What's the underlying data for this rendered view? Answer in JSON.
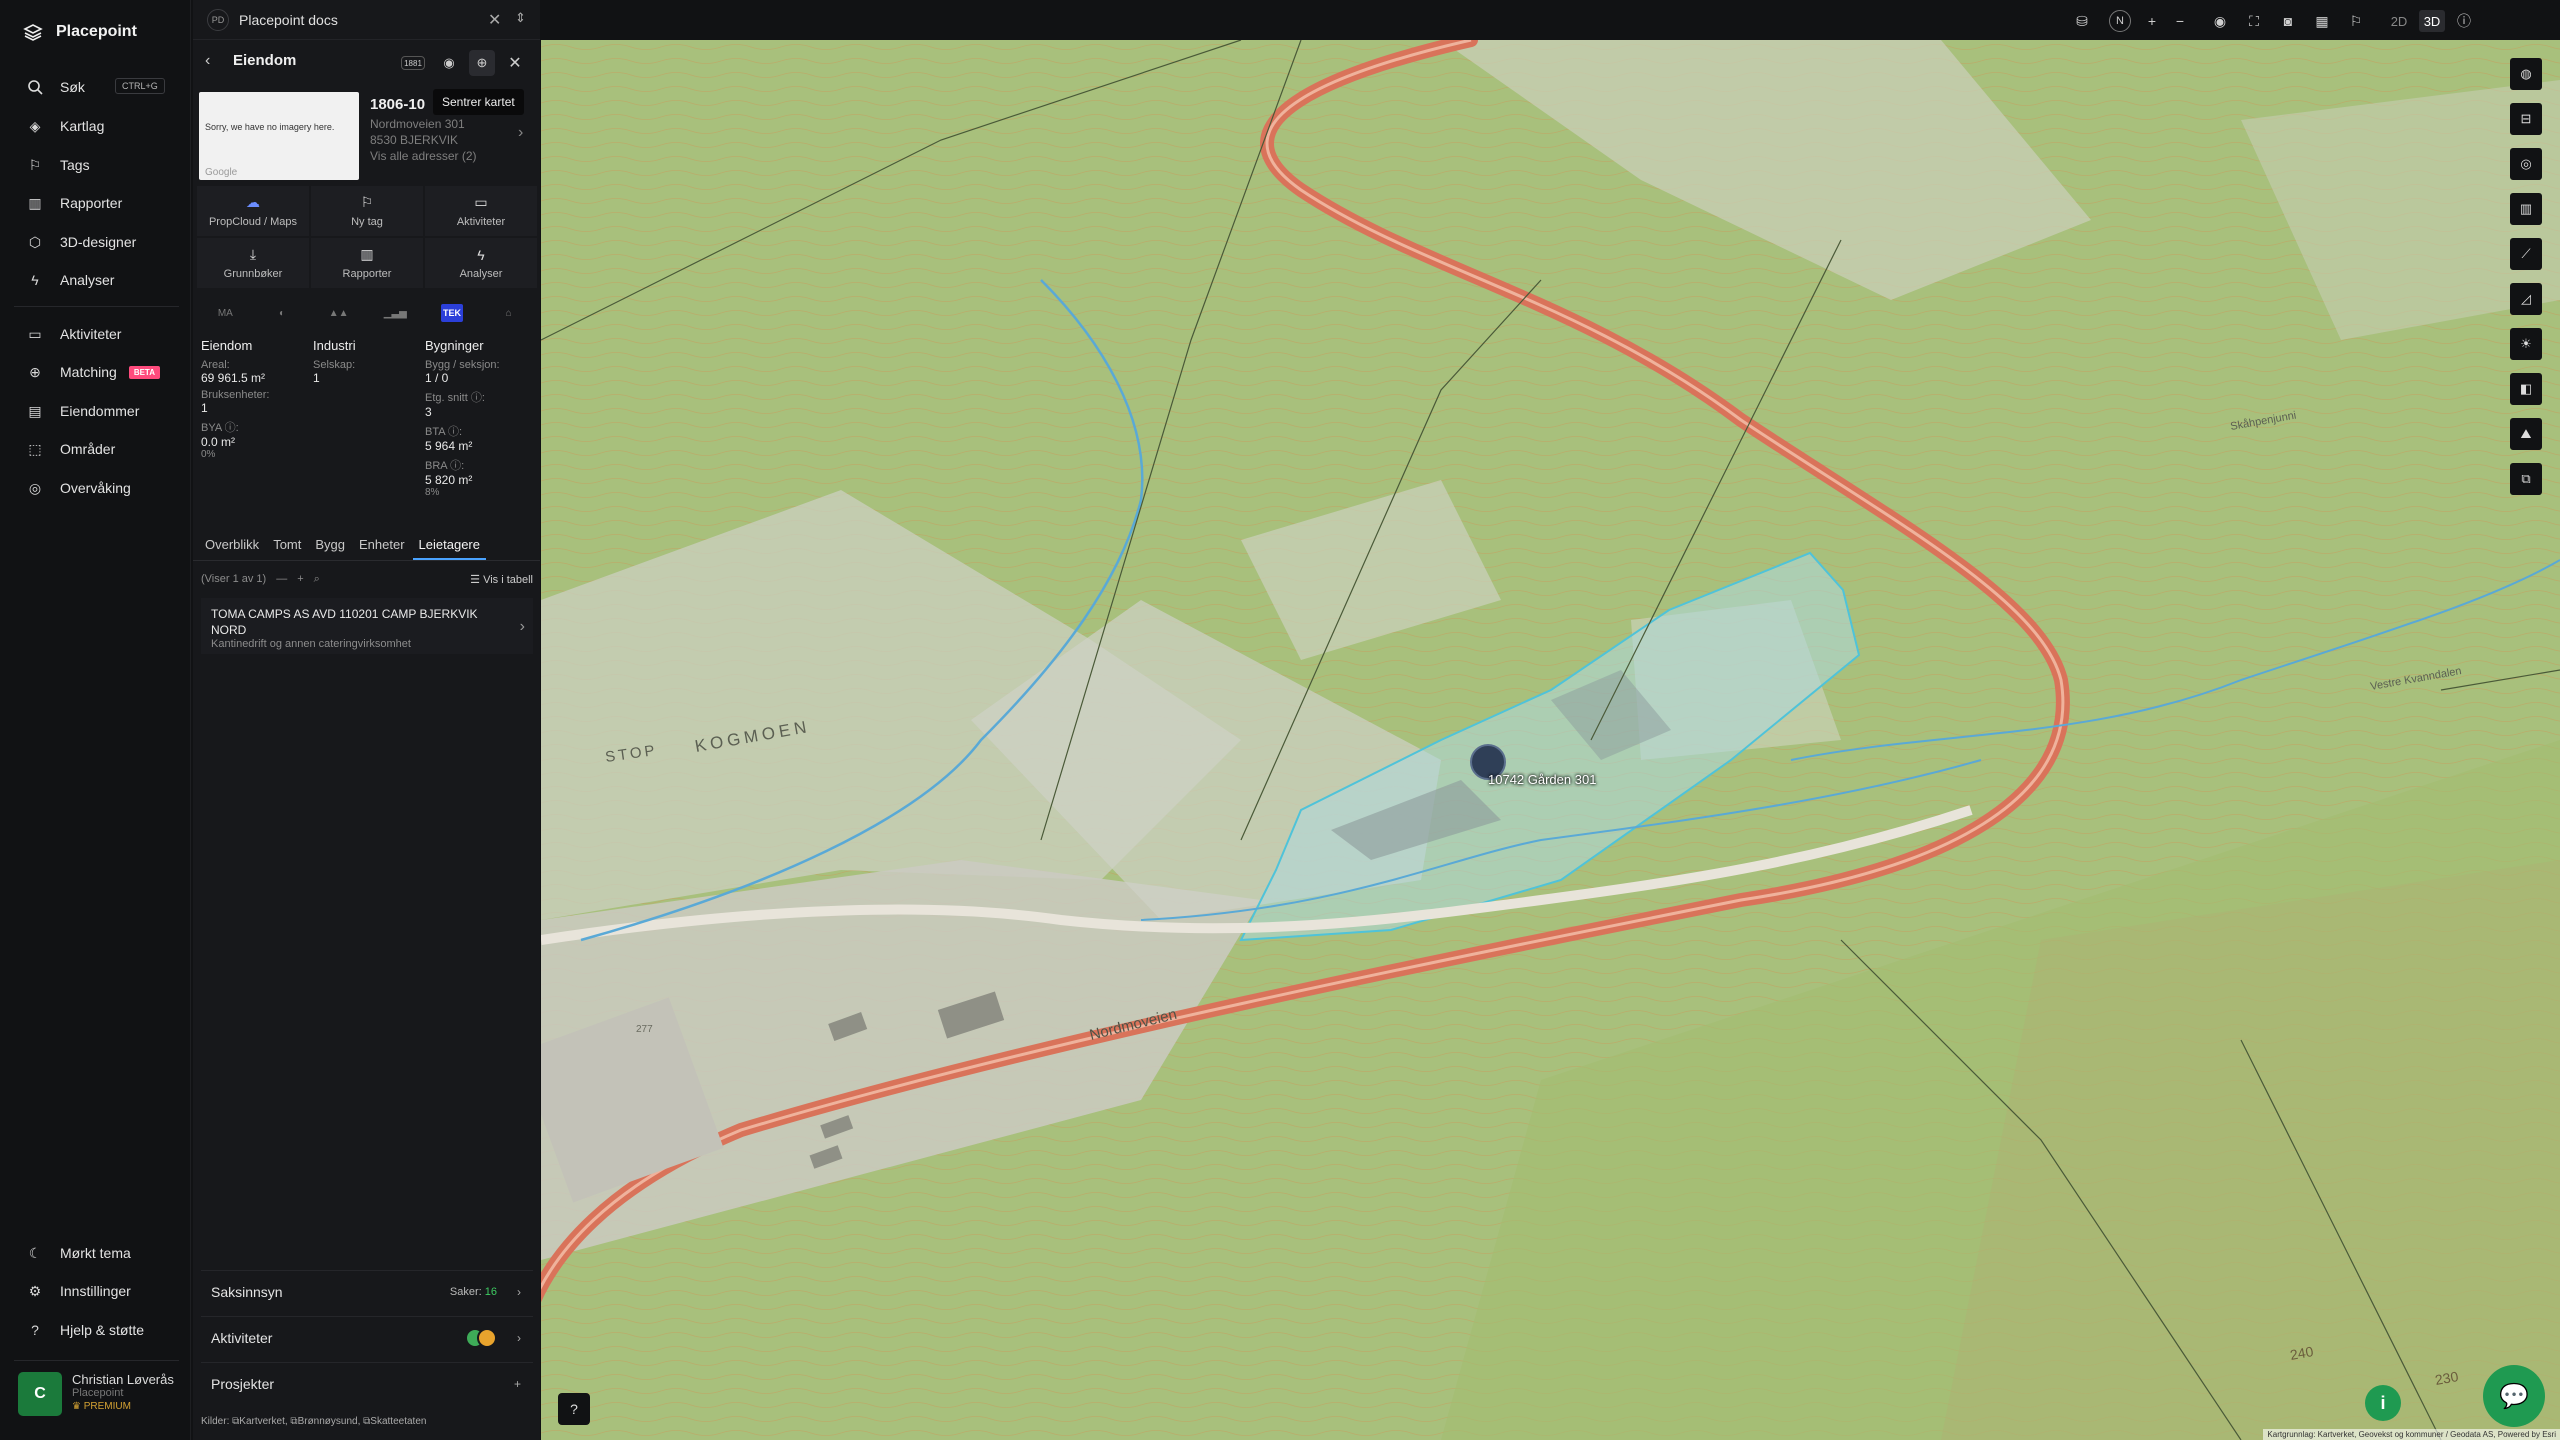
{
  "app": {
    "name": "Placepoint"
  },
  "nav": {
    "items": [
      {
        "label": "Søk",
        "shortcut": "CTRL+G",
        "icon": "search-icon"
      },
      {
        "label": "Kartlag",
        "icon": "layers-icon"
      },
      {
        "label": "Tags",
        "icon": "bookmark-icon"
      },
      {
        "label": "Rapporter",
        "icon": "bar-chart-icon"
      },
      {
        "label": "3D-designer",
        "icon": "cube-icon"
      },
      {
        "label": "Analyser",
        "icon": "bolt-icon"
      },
      {
        "label": "Aktiviteter",
        "icon": "chat-icon"
      },
      {
        "label": "Matching",
        "badge": "BETA",
        "icon": "match-icon"
      },
      {
        "label": "Eiendommer",
        "icon": "building-icon"
      },
      {
        "label": "Områder",
        "icon": "area-icon"
      },
      {
        "label": "Overvåking",
        "icon": "watch-icon"
      }
    ],
    "bottom": [
      {
        "label": "Mørkt tema",
        "icon": "moon-icon"
      },
      {
        "label": "Innstillinger",
        "icon": "gear-icon"
      },
      {
        "label": "Hjelp & støtte",
        "icon": "help-icon"
      }
    ],
    "user": {
      "initial": "C",
      "name": "Christian Løverås",
      "org": "Placepoint",
      "plan": "PREMIUM"
    }
  },
  "panel": {
    "doc": {
      "badge": "PD",
      "title": "Placepoint docs"
    },
    "header": {
      "title": "Eiendom",
      "tooltip": "Sentrer kartet",
      "badge": "1881"
    },
    "thumb": {
      "text": "Sorry, we have no imagery here.",
      "credit": "Google"
    },
    "property": {
      "id": "1806-10",
      "street": "Nordmoveien 301",
      "postal": "8530 BJERKVIK",
      "all_addresses": "Vis alle adresser (2)"
    },
    "actions": [
      {
        "label": "PropCloud / Maps",
        "icon": "cloud-icon"
      },
      {
        "label": "Ny tag",
        "icon": "bookmark-icon"
      },
      {
        "label": "Aktiviteter",
        "icon": "chat-icon"
      },
      {
        "label": "Grunnbøker",
        "icon": "download-icon"
      },
      {
        "label": "Rapporter",
        "icon": "bar-chart-icon"
      },
      {
        "label": "Analyser",
        "icon": "bolt-icon"
      }
    ],
    "categories": [
      "MA",
      "◐",
      "▲▲",
      "▁▃▅",
      "TEK",
      "⌂"
    ],
    "stats": {
      "eiendom": {
        "title": "Eiendom",
        "areal_k": "Areal:",
        "areal_v": "69 961.5 m²",
        "bruk_k": "Bruksenheter:",
        "bruk_v": "1",
        "bya_k": "BYA ⓘ:",
        "bya_v": "0.0 m²",
        "bya_p": "0%"
      },
      "industri": {
        "title": "Industri",
        "selskap_k": "Selskap:",
        "selskap_v": "1"
      },
      "bygninger": {
        "title": "Bygninger",
        "bygg_k": "Bygg / seksjon:",
        "bygg_v": "1 / 0",
        "etg_k": "Etg. snitt ⓘ:",
        "etg_v": "3",
        "bta_k": "BTA ⓘ:",
        "bta_v": "5 964 m²",
        "bra_k": "BRA ⓘ:",
        "bra_v": "5 820 m²",
        "bra_p": "8%"
      }
    },
    "tabs": [
      "Overblikk",
      "Tomt",
      "Bygg",
      "Enheter",
      "Leietagere"
    ],
    "active_tab": "Leietagere",
    "list": {
      "count": "(Viser 1 av 1)",
      "view_table": "Vis i tabell"
    },
    "tenant": {
      "name": "TOMA CAMPS AS AVD 110201 CAMP BJERKVIK NORD",
      "desc": "Kantinedrift og annen cateringvirksomhet"
    },
    "sections": {
      "saksinnsyn": "Saksinnsyn",
      "saker_label": "Saker:",
      "saker_count": "16",
      "aktiviteter": "Aktiviteter",
      "prosjekter": "Prosjekter"
    },
    "sources": {
      "label": "Kilder:",
      "items": [
        "Kartverket",
        "Brønnøysund",
        "Skatteetaten"
      ]
    }
  },
  "map": {
    "pin_label": "10742 Gården 301",
    "place_names": [
      "STOP",
      "KOGMOEN",
      "Nordmoveien",
      "Skåhpenjunni",
      "Vestre Kvanndalen",
      "277",
      "240",
      "230"
    ],
    "attribution": "Kartgrunnlag: Kartverket, Geovekst og kommuner / Geodata AS, Powered by Esri",
    "mode_2d": "2D",
    "mode_3d": "3D",
    "compass": "N"
  },
  "colors": {
    "accent": "#1f9a51",
    "road": "#d9735a",
    "parcel": "#4fc3d9",
    "terrain": "#a9c07f"
  }
}
